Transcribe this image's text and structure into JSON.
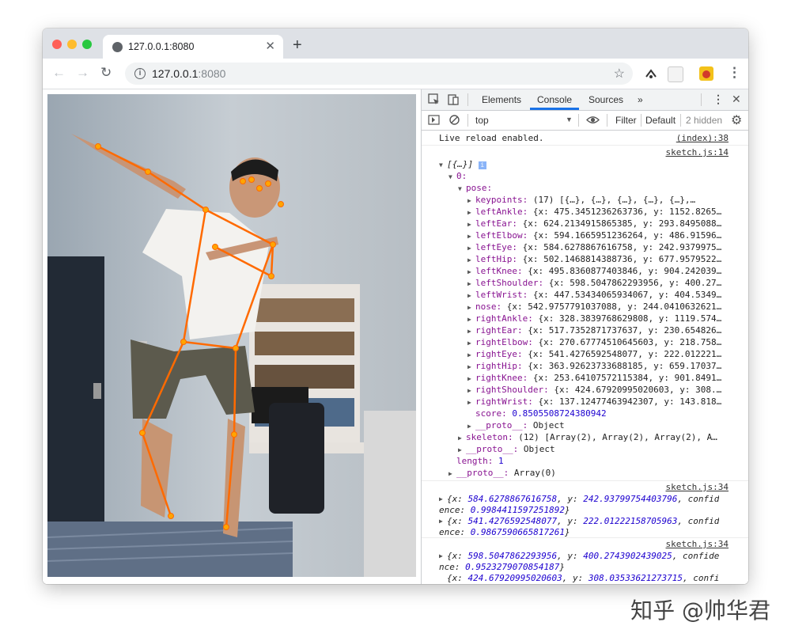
{
  "tab": {
    "title": "127.0.0.1:8080"
  },
  "address": {
    "host": "127.0.0.1",
    "port": ":8080"
  },
  "devtools": {
    "tabs": [
      "Elements",
      "Console",
      "Sources",
      "»"
    ],
    "context": "top",
    "filter_placeholder": "Filter",
    "levels": "Default",
    "hidden": "2 hidden"
  },
  "console": {
    "live_reload": "Live reload enabled.",
    "live_reload_src": "(index):38",
    "log1_src": "sketch.js:14",
    "array_header": "[{…}]",
    "index0": "0:",
    "pose": "pose:",
    "keypoints": {
      "key": "keypoints:",
      "value": "(17) [{…}, {…}, {…}, {…}, {…},…"
    },
    "pose_props": [
      {
        "key": "leftAnkle:",
        "value": "{x: 475.3451236263736, y: 1152.8265…"
      },
      {
        "key": "leftEar:",
        "value": "{x: 624.2134915865385, y: 293.8495088…"
      },
      {
        "key": "leftElbow:",
        "value": "{x: 594.1665951236264, y: 486.91596…"
      },
      {
        "key": "leftEye:",
        "value": "{x: 584.6278867616758, y: 242.9379975…"
      },
      {
        "key": "leftHip:",
        "value": "{x: 502.1468814388736, y: 677.9579522…"
      },
      {
        "key": "leftKnee:",
        "value": "{x: 495.8360877403846, y: 904.242039…"
      },
      {
        "key": "leftShoulder:",
        "value": "{x: 598.5047862293956, y: 400.27…"
      },
      {
        "key": "leftWrist:",
        "value": "{x: 447.53434065934067, y: 404.5349…"
      },
      {
        "key": "nose:",
        "value": "{x: 542.9757791037088, y: 244.0410632621…"
      },
      {
        "key": "rightAnkle:",
        "value": "{x: 328.3839768629808, y: 1119.574…"
      },
      {
        "key": "rightEar:",
        "value": "{x: 517.7352871737637, y: 230.654826…"
      },
      {
        "key": "rightElbow:",
        "value": "{x: 270.67774510645603, y: 218.758…"
      },
      {
        "key": "rightEye:",
        "value": "{x: 541.4276592548077, y: 222.012221…"
      },
      {
        "key": "rightHip:",
        "value": "{x: 363.92623733688185, y: 659.17037…"
      },
      {
        "key": "rightKnee:",
        "value": "{x: 253.64107572115384, y: 901.8491…"
      },
      {
        "key": "rightShoulder:",
        "value": "{x: 424.67920995020603, y: 308.…"
      },
      {
        "key": "rightWrist:",
        "value": "{x: 137.12477463942307, y: 143.818…"
      }
    ],
    "score": {
      "key": "score:",
      "value": "0.8505508724380942"
    },
    "pose_proto": {
      "key": "__proto__:",
      "value": "Object"
    },
    "skeleton": {
      "key": "skeleton:",
      "value": "(12) [Array(2), Array(2), Array(2), A…"
    },
    "index_proto": {
      "key": "__proto__:",
      "value": "Object"
    },
    "length": {
      "key": "length:",
      "value": "1"
    },
    "array_proto": {
      "key": "__proto__:",
      "value": "Array(0)"
    },
    "log2_src": "sketch.js:34",
    "log2_lines": [
      {
        "a": "{x: ",
        "x": "584.6278867616758",
        "b": ", y: ",
        "y": "242.93799754403796",
        "c": ", confid"
      },
      {
        "a": "ence: ",
        "x": "0.9984411597251892",
        "b": "}",
        "y": "",
        "c": ""
      },
      {
        "a": "{x: ",
        "x": "541.4276592548077",
        "b": ", y: ",
        "y": "222.01222158705963",
        "c": ", confid"
      },
      {
        "a": "ence: ",
        "x": "0.9867590665817261",
        "b": "}",
        "y": "",
        "c": ""
      }
    ],
    "log3_src": "sketch.js:34",
    "log3_lines": [
      {
        "a": "{x: ",
        "x": "598.5047862293956",
        "b": ", y: ",
        "y": "400.2743902439025",
        "c": ", confide"
      },
      {
        "a": "nce: ",
        "x": "0.9523279070854187",
        "b": "}",
        "y": "",
        "c": ""
      },
      {
        "a": "{x: ",
        "x": "424.67920995020603",
        "b": ", y: ",
        "y": "308.03533621273715",
        "c": ", confi"
      }
    ]
  },
  "watermark": "知乎 @帅华君"
}
